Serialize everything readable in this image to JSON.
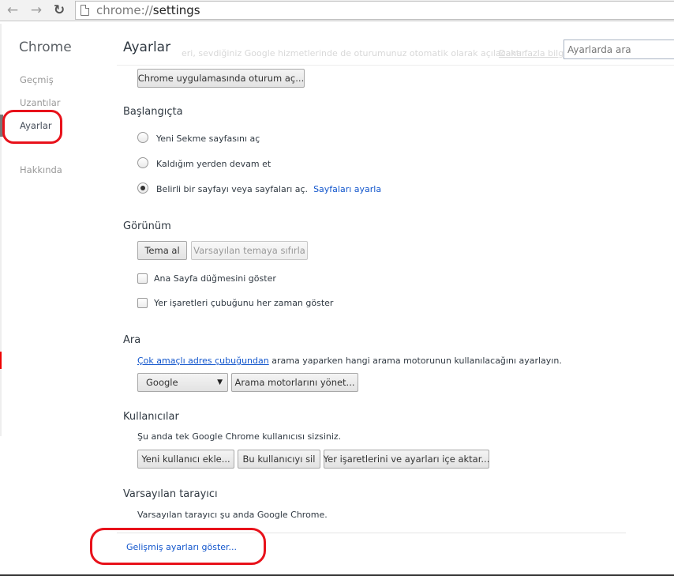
{
  "browser": {
    "url_scheme": "chrome://",
    "url_host": "settings",
    "back_glyph": "←",
    "forward_glyph": "→",
    "reload_glyph": "↻"
  },
  "sidebar": {
    "title": "Chrome",
    "items": [
      {
        "label": "Geçmiş"
      },
      {
        "label": "Uzantılar"
      },
      {
        "label": "Ayarlar"
      },
      {
        "label": "Hakkında"
      }
    ]
  },
  "header": {
    "title": "Ayarlar",
    "search_placeholder": "Ayarlarda ara",
    "faded_text": "eri, sevdiğiniz Google hizmetlerinde de oturumunuz otomatik olarak açılacaktır.",
    "faded_link": "Daha fazla bilgi"
  },
  "signin": {
    "button": "Chrome uygulamasında oturum aç..."
  },
  "startup": {
    "title": "Başlangıçta",
    "options": [
      {
        "label": "Yeni Sekme sayfasını aç"
      },
      {
        "label": "Kaldığım yerden devam et"
      },
      {
        "label": "Belirli bir sayfayı veya sayfaları aç."
      }
    ],
    "set_pages_link": "Sayfaları ayarla"
  },
  "appearance": {
    "title": "Görünüm",
    "get_theme": "Tema al",
    "reset_theme": "Varsayılan temaya sıfırla",
    "show_home": "Ana Sayfa düğmesini göster",
    "show_bookmarks": "Yer işaretleri çubuğunu her zaman göster"
  },
  "search_section": {
    "title": "Ara",
    "omnibox_link": "Çok amaçlı adres çubuğundan",
    "desc_rest": " arama yaparken hangi arama motorunun kullanılacağını ayarlayın.",
    "engine_selected": "Google",
    "manage_button": "Arama motorlarını yönet..."
  },
  "users": {
    "title": "Kullanıcılar",
    "desc": "Şu anda tek Google Chrome kullanıcısı sizsiniz.",
    "add_user": "Yeni kullanıcı ekle...",
    "delete_user": "Bu kullanıcıyı sil",
    "import": "Yer işaretlerini ve ayarları içe aktar..."
  },
  "default_browser": {
    "title": "Varsayılan tarayıcı",
    "desc": "Varsayılan tarayıcı şu anda Google Chrome."
  },
  "advanced_link": "Gelişmiş ayarları göster...",
  "colors": {
    "link": "#1155cc",
    "annotation": "#e8121b"
  }
}
